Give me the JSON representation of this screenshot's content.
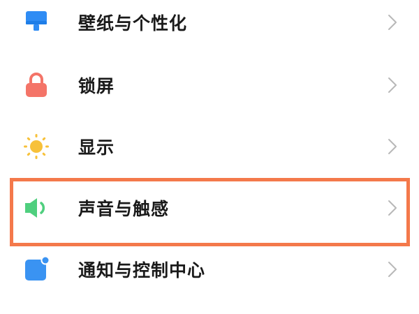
{
  "settings": {
    "items": [
      {
        "label": "壁纸与个性化",
        "icon": "wallpaper-brush-icon",
        "icon_color": "#2f8cf4"
      },
      {
        "label": "锁屏",
        "icon": "padlock-icon",
        "icon_color": "#f47468"
      },
      {
        "label": "显示",
        "icon": "sun-icon",
        "icon_color": "#f7c13a"
      },
      {
        "label": "声音与触感",
        "icon": "speaker-icon",
        "icon_color": "#4fcf7e"
      },
      {
        "label": "通知与控制中心",
        "icon": "notification-square-icon",
        "icon_color": "#3a93f2"
      }
    ]
  },
  "highlight": {
    "target": "声音与触感",
    "color": "#f4794b"
  },
  "chevron_color": "#b8b8b8"
}
